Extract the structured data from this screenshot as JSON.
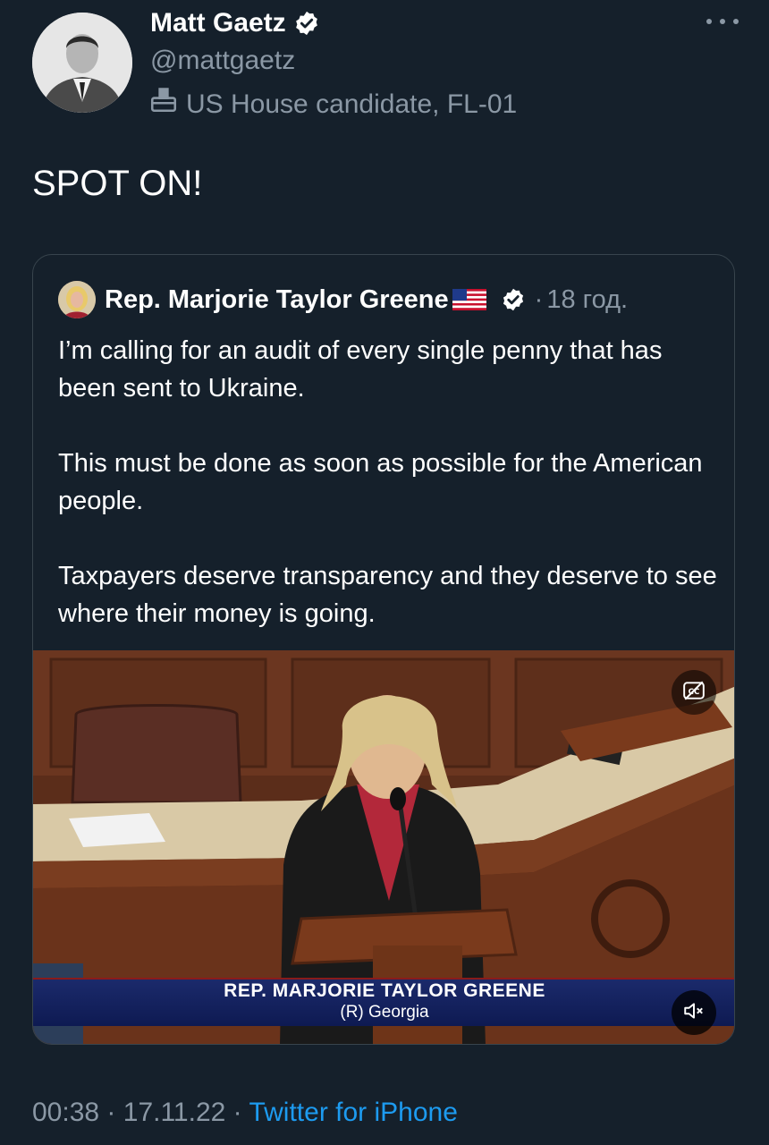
{
  "author": {
    "name": "Matt Gaetz",
    "handle": "@mattgaetz",
    "label": "US House candidate, FL-01",
    "label_icon": "ballot-box-icon",
    "verified_icon": "verified-badge-icon"
  },
  "tweet": {
    "text": "SPOT ON!",
    "time": "00:38",
    "separator": "·",
    "date": "17.11.22",
    "source": "Twitter for iPhone"
  },
  "quoted": {
    "name": "Rep. Marjorie Taylor Greene",
    "flag_icon": "us-flag-icon",
    "verified_icon": "verified-badge-icon",
    "time_prefix": "·",
    "time": "18 год.",
    "paragraphs": [
      "I’m calling for an audit of every single penny that has been sent to Ukraine.",
      "This must be done as soon as possible for the American people.",
      "Taxpayers deserve transparency and they deserve to see where their money is going."
    ],
    "video": {
      "lower_third_name": "REP. MARJORIE TAYLOR GREENE",
      "lower_third_party": "(R) Georgia",
      "cc_icon": "closed-captions-icon",
      "mute_icon": "muted-speaker-icon"
    }
  },
  "colors": {
    "background": "#15202b",
    "text": "#ffffff",
    "secondary": "#8b98a5",
    "link": "#1d9bf0",
    "border": "#38444d"
  }
}
